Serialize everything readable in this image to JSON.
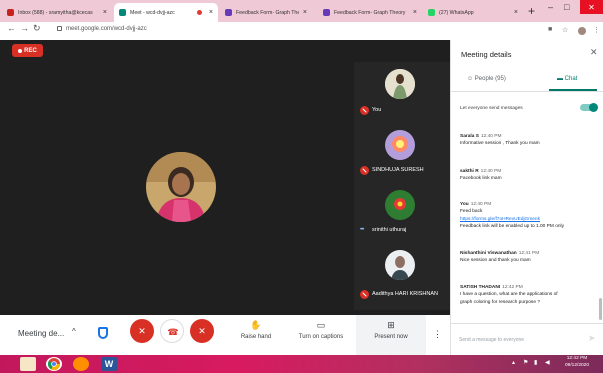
{
  "browser": {
    "tabs": [
      {
        "title": "Inbox (588) - sramyitha@kcecas",
        "fav_color": "#c5221f",
        "active": false
      },
      {
        "title": "Meet - wcd-dvjj-azc",
        "fav_color": "#00897b",
        "active": true
      },
      {
        "title": "Feedback Form- Graph Theory",
        "fav_color": "#673ab7",
        "active": false
      },
      {
        "title": "Feedback Form- Graph Theory",
        "fav_color": "#673ab7",
        "active": false
      },
      {
        "title": "(27) WhatsApp",
        "fav_color": "#25d366",
        "active": false
      }
    ],
    "new_tab": "+",
    "url": "meet.google.com/wcd-dvjj-azc"
  },
  "meet": {
    "rec_label": "REC",
    "participants": [
      {
        "name": "You",
        "muted": true
      },
      {
        "name": "SINDHUJA SURESH",
        "muted": true
      },
      {
        "name": "srinithi uthuraj",
        "muted": false
      },
      {
        "name": "Aadithya HARI KRISHNAN",
        "muted": true
      }
    ],
    "toolbar": {
      "meeting_name": "Meeting de...",
      "raise_hand": "Raise hand",
      "captions": "Turn on captions",
      "present": "Present now"
    }
  },
  "panel": {
    "title": "Meeting details",
    "people_tab": "People (95)",
    "chat_tab": "Chat",
    "everyone_label": "Let everyone send messages",
    "everyone_enabled": true,
    "messages": [
      {
        "sender": "Sarala S",
        "time": "12:40 PM",
        "lines": [
          "Informative session , Thank you mam"
        ]
      },
      {
        "sender": "sakthi R",
        "time": "12:40 PM",
        "lines": [
          "Facebook link mam"
        ]
      },
      {
        "sender": "You",
        "time": "12:40 PM",
        "lines": [
          "Feed back"
        ],
        "link": "https://forms.gle/f7oHRevUEdjGmenk",
        "after": "Feedback link will be enabled up to 1.00 PM only"
      },
      {
        "sender": "Nishanthini Viswanathan",
        "time": "12:41 PM",
        "lines": [
          "Nice session and thank you mam"
        ]
      },
      {
        "sender": "SATISH THADANI",
        "time": "12:42 PM",
        "lines": [
          "I have a question, what are the applications of",
          "graph coloring for research purpose ?"
        ]
      }
    ],
    "send_placeholder": "Send a message to everyone"
  },
  "taskbar": {
    "clock_time": "12:42 PM",
    "clock_date": "09/12/2020"
  }
}
